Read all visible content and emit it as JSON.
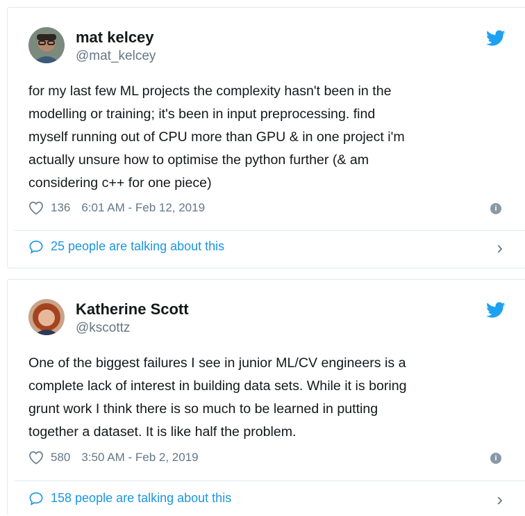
{
  "colors": {
    "text": "#14171a",
    "secondary_text": "#657786",
    "link_blue": "#1b95e0",
    "twitter_blue": "#1da1f2",
    "border": "#e1e8ed"
  },
  "tweets": [
    {
      "author_name": "mat kelcey",
      "author_handle": "@mat_kelcey",
      "text": "for my last few ML projects the complexity hasn't been in the\nmodelling or training; it's been in input preprocessing. find\nmyself running out of CPU more than GPU & in one project i'm\nactually unsure how to optimise the python further (& am\nconsidering c++ for one piece)",
      "likes": "136",
      "timestamp": "6:01 AM - Feb 12, 2019",
      "talking_about": "25 people are talking about this",
      "icons": [
        "heart-icon",
        "info-icon",
        "chat-bubble-icon",
        "chevron-right-icon",
        "twitter-bird-icon"
      ]
    },
    {
      "author_name": "Katherine Scott",
      "author_handle": "@kscottz",
      "text": "One of the biggest failures I see in junior ML/CV engineers is a\ncomplete lack of interest in building data sets. While it is boring\ngrunt work I think there is so much to be learned in putting\ntogether a dataset. It is like half the problem.",
      "likes": "580",
      "timestamp": "3:50 AM - Feb 2, 2019",
      "talking_about": "158 people are talking about this",
      "icons": [
        "heart-icon",
        "info-icon",
        "chat-bubble-icon",
        "chevron-right-icon",
        "twitter-bird-icon"
      ]
    }
  ]
}
